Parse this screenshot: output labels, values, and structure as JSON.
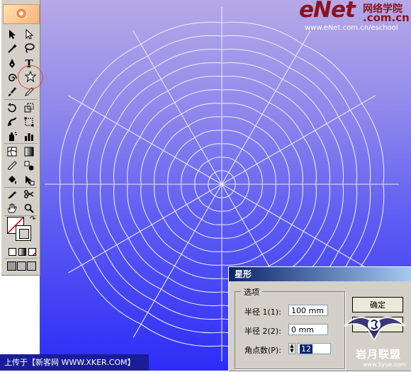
{
  "brand": {
    "main": "eNet",
    "cn": "网络学院",
    "com": ".com.cn",
    "url": "www.eNet.com.cn/eschool"
  },
  "toolbar": {
    "tools": [
      "selection-icon",
      "direct-selection-icon",
      "magic-wand-icon",
      "lasso-icon",
      "pen-icon",
      "type-icon",
      "spiral-icon",
      "star-icon",
      "paintbrush-icon",
      "pencil-icon",
      "rotate-icon",
      "scale-icon",
      "warp-icon",
      "free-transform-icon",
      "symbol-sprayer-icon",
      "column-graph-icon",
      "mesh-icon",
      "gradient-icon",
      "eyedropper-icon",
      "blend-icon",
      "live-paint-bucket-icon",
      "live-paint-selection-icon",
      "slice-icon",
      "scissors-icon",
      "hand-icon",
      "zoom-icon"
    ]
  },
  "dialog": {
    "title": "星形",
    "group_label": "选项",
    "radius1_label": "半径 1(1):",
    "radius1_value": "100 mm",
    "radius2_label": "半径 2(2):",
    "radius2_value": "0 mm",
    "points_label": "角点数(P):",
    "points_value": "12",
    "ok_label": "确定"
  },
  "watermark": {
    "text": "岩月联盟",
    "url": "www.5yue.com"
  },
  "caption": "上传于【新客网 WWW.XKER.COM】",
  "colors": {
    "canvas_top": "#b7a9e6",
    "canvas_bottom": "#2d2cf7",
    "highlight": "#e0404a"
  }
}
